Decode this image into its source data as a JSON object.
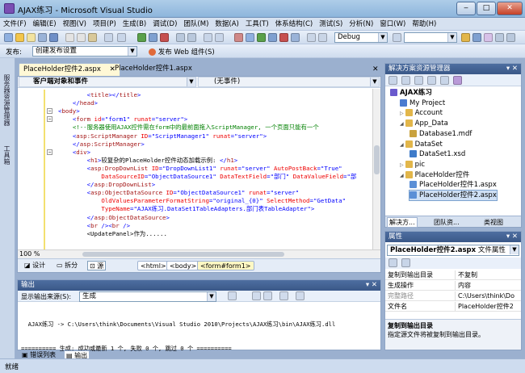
{
  "window": {
    "title": "AJAX练习 - Microsoft Visual Studio",
    "min": "‒",
    "max": "□",
    "close": "✕"
  },
  "menu": [
    "文件(F)",
    "编辑(E)",
    "视图(V)",
    "项目(P)",
    "生成(B)",
    "调试(D)",
    "团队(M)",
    "数据(A)",
    "工具(T)",
    "体系结构(C)",
    "测试(S)",
    "分析(N)",
    "窗口(W)",
    "帮助(H)"
  ],
  "toolbar": {
    "config": "Debug",
    "publish_label": "发布:",
    "publish_value": "创建发布设置",
    "web_button": "发布 Web",
    "web_suffix": "组件(S)"
  },
  "left_strip": {
    "label1": "服务器资源管理器",
    "label2": "工具箱"
  },
  "tabs": [
    {
      "label": "PlaceHolder控件2.aspx"
    },
    {
      "label": "PlaceHolder控件1.aspx"
    }
  ],
  "editor": {
    "object_combo": "客户端对象和事件",
    "event_combo": "(无事件)",
    "zoom": "100 %",
    "view_design": "设计",
    "view_split": "拆分",
    "view_source": "源",
    "crumbs": [
      "<html>",
      "<body>",
      "<form#form1>"
    ]
  },
  "code_lines": [
    [
      [
        "tx",
        "        "
      ],
      [
        "pu",
        "<"
      ],
      [
        "tg",
        "title"
      ],
      [
        "pu",
        "></"
      ],
      [
        "tg",
        "title"
      ],
      [
        "pu",
        ">"
      ]
    ],
    [
      [
        "tx",
        "    "
      ],
      [
        "pu",
        "</"
      ],
      [
        "tg",
        "head"
      ],
      [
        "pu",
        ">"
      ]
    ],
    [
      [
        "pu",
        "<"
      ],
      [
        "tg",
        "body"
      ],
      [
        "pu",
        ">"
      ]
    ],
    [
      [
        "tx",
        "    "
      ],
      [
        "pu",
        "<"
      ],
      [
        "tg",
        "form "
      ],
      [
        "at",
        "id"
      ],
      [
        "pu",
        "="
      ],
      [
        "st",
        "\"form1\" "
      ],
      [
        "at",
        "runat"
      ],
      [
        "pu",
        "="
      ],
      [
        "st",
        "\"server\""
      ],
      [
        "pu",
        ">"
      ]
    ],
    [
      [
        "tx",
        "    "
      ],
      [
        "cm",
        "<!--服务器使用AJAX控件需在form中的最前面拖入ScriptManager, 一个页面只能有一个"
      ]
    ],
    [
      [
        "tx",
        "    "
      ],
      [
        "pu",
        "<"
      ],
      [
        "tg",
        "asp:ScriptManager "
      ],
      [
        "at",
        "ID"
      ],
      [
        "pu",
        "="
      ],
      [
        "st",
        "\"ScriptManager1\" "
      ],
      [
        "at",
        "runat"
      ],
      [
        "pu",
        "="
      ],
      [
        "st",
        "\"server\""
      ],
      [
        "pu",
        ">"
      ]
    ],
    [
      [
        "tx",
        "    "
      ],
      [
        "pu",
        "</"
      ],
      [
        "tg",
        "asp:ScriptManager"
      ],
      [
        "pu",
        ">"
      ]
    ],
    [
      [
        "tx",
        "    "
      ],
      [
        "pu",
        "<"
      ],
      [
        "tg",
        "div"
      ],
      [
        "pu",
        ">"
      ]
    ],
    [
      [
        "tx",
        "        "
      ],
      [
        "pu",
        "<"
      ],
      [
        "tg",
        "h1"
      ],
      [
        "pu",
        ">"
      ],
      [
        "tx",
        "较复杂的PlaceHolder控件动态加载示例: "
      ],
      [
        "pu",
        "</"
      ],
      [
        "tg",
        "h1"
      ],
      [
        "pu",
        ">"
      ]
    ],
    [
      [
        "tx",
        "        "
      ],
      [
        "pu",
        "<"
      ],
      [
        "tg",
        "asp:DropDownList "
      ],
      [
        "at",
        "ID"
      ],
      [
        "pu",
        "="
      ],
      [
        "st",
        "\"DropDownList1\" "
      ],
      [
        "at",
        "runat"
      ],
      [
        "pu",
        "="
      ],
      [
        "st",
        "\"server\" "
      ],
      [
        "at",
        "AutoPostBack"
      ],
      [
        "pu",
        "="
      ],
      [
        "st",
        "\"True\""
      ]
    ],
    [
      [
        "tx",
        "            "
      ],
      [
        "at",
        "DataSourceID"
      ],
      [
        "pu",
        "="
      ],
      [
        "st",
        "\"ObjectDataSource1\" "
      ],
      [
        "at",
        "DataTextField"
      ],
      [
        "pu",
        "="
      ],
      [
        "st",
        "\"部门\" "
      ],
      [
        "at",
        "DataValueField"
      ],
      [
        "pu",
        "="
      ],
      [
        "st",
        "\"部"
      ]
    ],
    [
      [
        "tx",
        "        "
      ],
      [
        "pu",
        "</"
      ],
      [
        "tg",
        "asp:DropDownList"
      ],
      [
        "pu",
        ">"
      ]
    ],
    [
      [
        "tx",
        "        "
      ],
      [
        "pu",
        "<"
      ],
      [
        "tg",
        "asp:ObjectDataSource "
      ],
      [
        "at",
        "ID"
      ],
      [
        "pu",
        "="
      ],
      [
        "st",
        "\"ObjectDataSource1\" "
      ],
      [
        "at",
        "runat"
      ],
      [
        "pu",
        "="
      ],
      [
        "st",
        "\"server\""
      ]
    ],
    [
      [
        "tx",
        "            "
      ],
      [
        "at",
        "OldValuesParameterFormatString"
      ],
      [
        "pu",
        "="
      ],
      [
        "st",
        "\"original_{0}\" "
      ],
      [
        "at",
        "SelectMethod"
      ],
      [
        "pu",
        "="
      ],
      [
        "st",
        "\"GetData\""
      ]
    ],
    [
      [
        "tx",
        "            "
      ],
      [
        "at",
        "TypeName"
      ],
      [
        "pu",
        "="
      ],
      [
        "st",
        "\"AJAX练习.DataSet1TableAdapters.部门表TableAdapter\""
      ],
      [
        "pu",
        ">"
      ]
    ],
    [
      [
        "tx",
        "        "
      ],
      [
        "pu",
        "</"
      ],
      [
        "tg",
        "asp:ObjectDataSource"
      ],
      [
        "pu",
        ">"
      ]
    ],
    [
      [
        "tx",
        "        "
      ],
      [
        "pu",
        "<"
      ],
      [
        "tg",
        "br "
      ],
      [
        "pu",
        "/><"
      ],
      [
        "tg",
        "br "
      ],
      [
        "pu",
        "/>"
      ]
    ],
    [
      [
        "tx",
        "        "
      ],
      [
        "tx",
        "<UpdatePanel>作为......"
      ]
    ]
  ],
  "output": {
    "title": "输出",
    "source_label": "显示输出来源(S):",
    "source_value": "生成",
    "lines": [
      "  AJAX练习 -> C:\\Users\\think\\Documents\\Visual Studio 2010\\Projects\\AJAX练习\\bin\\AJAX练习.dll",
      "========== 生成: 成功或最新 1 个, 失败 0 个, 跳过 0 个 =========="
    ]
  },
  "bottom_tabs": {
    "errors": "错误列表",
    "output": "输出"
  },
  "status": "就绪",
  "solution": {
    "title": "解决方案资源管理器",
    "tree": [
      {
        "label": "AJAX练习",
        "indent": 0,
        "color": "#6a5acd",
        "bold": true
      },
      {
        "label": "My Project",
        "indent": 1,
        "color": "#4a7bd0"
      },
      {
        "label": "Account",
        "indent": 1,
        "color": "#e2b64a",
        "expander": "▷"
      },
      {
        "label": "App_Data",
        "indent": 1,
        "color": "#e2b64a",
        "expander": "◢"
      },
      {
        "label": "Database1.mdf",
        "indent": 2,
        "color": "#c9a23e"
      },
      {
        "label": "DataSet",
        "indent": 1,
        "color": "#e2b64a",
        "expander": "◢"
      },
      {
        "label": "DataSet1.xsd",
        "indent": 2,
        "color": "#3e7bc9"
      },
      {
        "label": "pic",
        "indent": 1,
        "color": "#e2b64a",
        "expander": "▷"
      },
      {
        "label": "PlaceHolder控件",
        "indent": 1,
        "color": "#e2b64a",
        "expander": "◢"
      },
      {
        "label": "PlaceHolder控件1.aspx",
        "indent": 2,
        "color": "#5b8fd6"
      },
      {
        "label": "PlaceHolder控件2.aspx",
        "indent": 2,
        "color": "#5b8fd6",
        "selected": true
      }
    ],
    "tabs": [
      "解决方...",
      "团队资...",
      "类视图"
    ]
  },
  "properties": {
    "title": "属性",
    "object_name": "PlaceHolder控件2.aspx",
    "object_type": "文件属性",
    "rows": [
      {
        "key": "复制到输出目录",
        "value": "不复制"
      },
      {
        "key": "生成操作",
        "value": "内容"
      },
      {
        "key": "完整路径",
        "value": "C:\\Users\\think\\Do"
      },
      {
        "key": "文件名",
        "value": "PlaceHolder控件2"
      }
    ],
    "desc_title": "复制到输出目录",
    "desc_text": "指定源文件将被复制到输出目录。"
  }
}
